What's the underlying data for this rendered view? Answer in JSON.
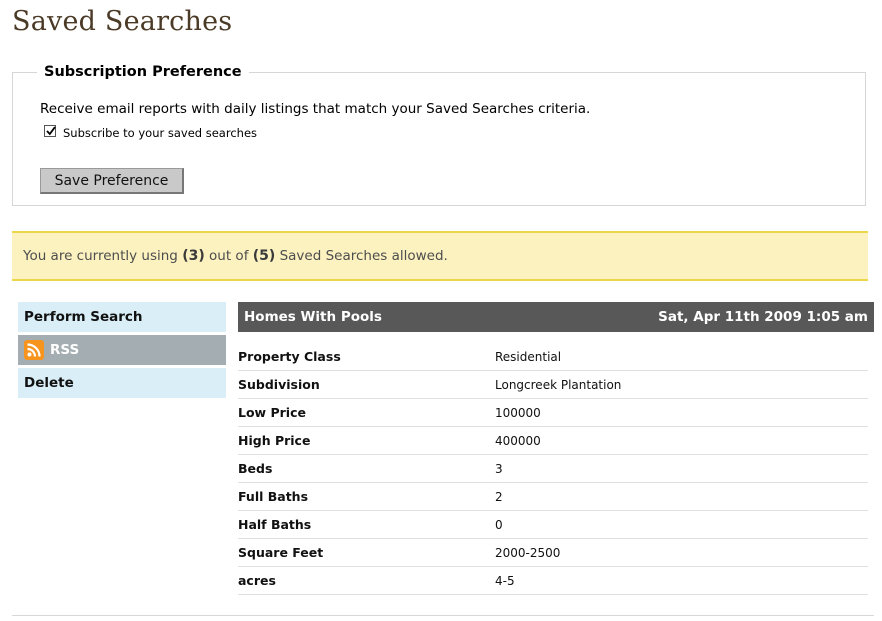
{
  "page": {
    "title": "Saved Searches"
  },
  "subscription": {
    "legend": "Subscription Preference",
    "description": "Receive email reports with daily listings that match your Saved Searches criteria.",
    "checkbox_label": "Subscribe to your saved searches",
    "checkbox_checked": true,
    "save_label": "Save Preference"
  },
  "notice": {
    "prefix": "You are currently using ",
    "used": "(3)",
    "middle": " out of ",
    "allowed": "(5)",
    "suffix": " Saved Searches allowed."
  },
  "actions": {
    "perform": "Perform Search",
    "rss": "RSS",
    "delete": "Delete"
  },
  "search": {
    "name": "Homes With Pools",
    "date": "Sat, Apr 11th 2009 1:05 am",
    "criteria": [
      {
        "label": "Property Class",
        "value": "Residential"
      },
      {
        "label": "Subdivision",
        "value": "Longcreek Plantation"
      },
      {
        "label": "Low Price",
        "value": "100000"
      },
      {
        "label": "High Price",
        "value": "400000"
      },
      {
        "label": "Beds",
        "value": "3"
      },
      {
        "label": "Full Baths",
        "value": "2"
      },
      {
        "label": "Half Baths",
        "value": "0"
      },
      {
        "label": "Square Feet",
        "value": "2000-2500"
      },
      {
        "label": "acres",
        "value": "4-5"
      }
    ]
  },
  "colors": {
    "title": "#4a3a26",
    "notice_bg": "#fbf2c0",
    "notice_border": "#ecd64a",
    "menu_bg": "#d9eef6",
    "rss_bg": "#a4aeb2",
    "header_bg": "#585858",
    "rss_icon": "#f7941d"
  }
}
